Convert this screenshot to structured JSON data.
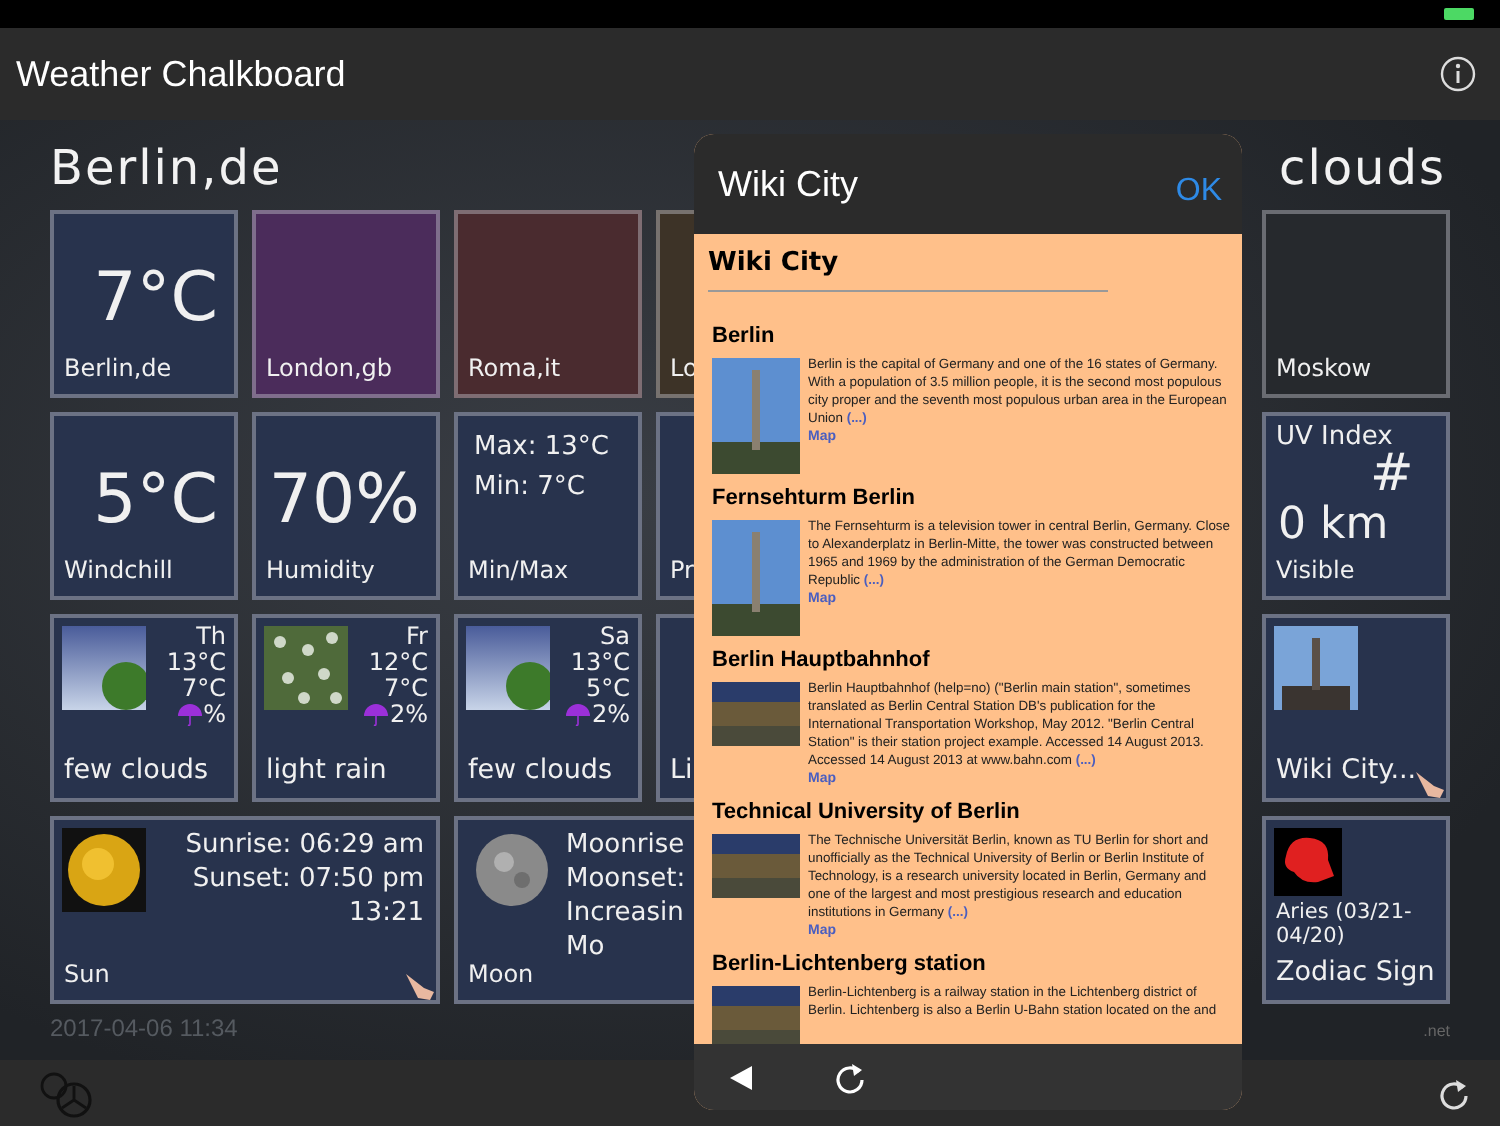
{
  "app_bar": {
    "title": "Weather Chalkboard"
  },
  "location": {
    "city": "Berlin,de",
    "condition": "clouds"
  },
  "rows": [
    {
      "tiles": [
        {
          "kind": "city",
          "value": "7°C",
          "label": "Berlin,de",
          "color": "#28334d"
        },
        {
          "kind": "city",
          "label": "London,gb",
          "color": "#4b2c5b"
        },
        {
          "kind": "city",
          "label": "Roma,it",
          "color": "#4a2b2f"
        },
        {
          "kind": "city",
          "label": "Lo",
          "color": "#3d3327"
        },
        {
          "kind": "city",
          "label": "Moskow",
          "color": "#26292d"
        }
      ]
    },
    {
      "tiles": [
        {
          "kind": "value",
          "value": "5°C",
          "label": "Windchill"
        },
        {
          "kind": "value",
          "value": "70%",
          "label": "Humidity"
        },
        {
          "kind": "minmax",
          "max": "Max: 13°C",
          "min": "Min: 7°C",
          "label": "Min/Max"
        },
        {
          "kind": "value",
          "label": "Pr"
        },
        {
          "kind": "uv",
          "title": "UV Index",
          "value": "#",
          "distance": "0 km",
          "label": "Visible"
        }
      ]
    },
    {
      "tiles": [
        {
          "kind": "cloudy",
          "day": "Th",
          "high": "13°C",
          "low": "7°C",
          "rain": "%",
          "label": "few clouds"
        },
        {
          "kind": "rainy",
          "day": "Fr",
          "high": "12°C",
          "low": "7°C",
          "rain": "2%",
          "label": "light rain"
        },
        {
          "kind": "cloudy",
          "day": "Sa",
          "high": "13°C",
          "low": "5°C",
          "rain": "2%",
          "label": "few clouds"
        },
        {
          "kind": "forecast",
          "label": "Li"
        },
        {
          "kind": "wiki",
          "label": "Wiki City..."
        }
      ]
    },
    {
      "tiles": [
        {
          "kind": "sun",
          "lines": [
            "Sunrise: 06:29 am",
            "Sunset: 07:50 pm",
            "13:21"
          ],
          "label": "Sun"
        },
        {
          "kind": "moon",
          "lines": [
            "Moonrise",
            "Moonset:",
            "Increasin",
            "Mo"
          ],
          "label": "Moon"
        },
        {
          "kind": "zodiac",
          "sign": "Aries (03/21-04/20)",
          "label": "Zodiac Sign"
        }
      ]
    }
  ],
  "footer": {
    "updated": "2017-04-06 11:34",
    "credit": ".net"
  },
  "popover": {
    "title": "Wiki City",
    "ok": "OK",
    "heading": "Wiki City",
    "entries": [
      {
        "title": "Berlin",
        "kind": "portrait",
        "text": "Berlin is the capital of Germany and one of the 16 states of Germany. With a population of 3.5 million people, it is the second most populous city proper and the seventh most populous urban area in the European Union",
        "more": "(...)",
        "map": "Map"
      },
      {
        "title": "Fernsehturm Berlin",
        "kind": "portrait",
        "text": "The Fernsehturm is a television tower in central Berlin, Germany. Close to Alexanderplatz in Berlin-Mitte, the tower was constructed between 1965 and 1969 by the administration of the German Democratic Republic",
        "more": "(...)",
        "map": "Map"
      },
      {
        "title": "Berlin Hauptbahnhof",
        "kind": "landscape",
        "text": "Berlin Hauptbahnhof (help=no) (\"Berlin main station\", sometimes translated as Berlin Central Station DB's publication for the International Transportation Workshop, May 2012. \"Berlin Central Station\" is their station project example. Accessed 14 August 2013. Accessed 14 August 2013 at www.bahn.com",
        "more": "(...)",
        "map": "Map"
      },
      {
        "title": "Technical University of Berlin",
        "kind": "landscape",
        "text": "The Technische Universität Berlin, known as TU Berlin for short and unofficially as the Technical University of Berlin or Berlin Institute of Technology, is a research university located in Berlin, Germany and one of the largest and most prestigious research and education institutions in Germany",
        "more": "(...)",
        "map": "Map"
      },
      {
        "title": "Berlin-Lichtenberg station",
        "kind": "landscape",
        "text": "Berlin-Lichtenberg is a railway station in the Lichtenberg district of Berlin. Lichtenberg is also a Berlin U-Bahn station located on the and"
      }
    ]
  }
}
